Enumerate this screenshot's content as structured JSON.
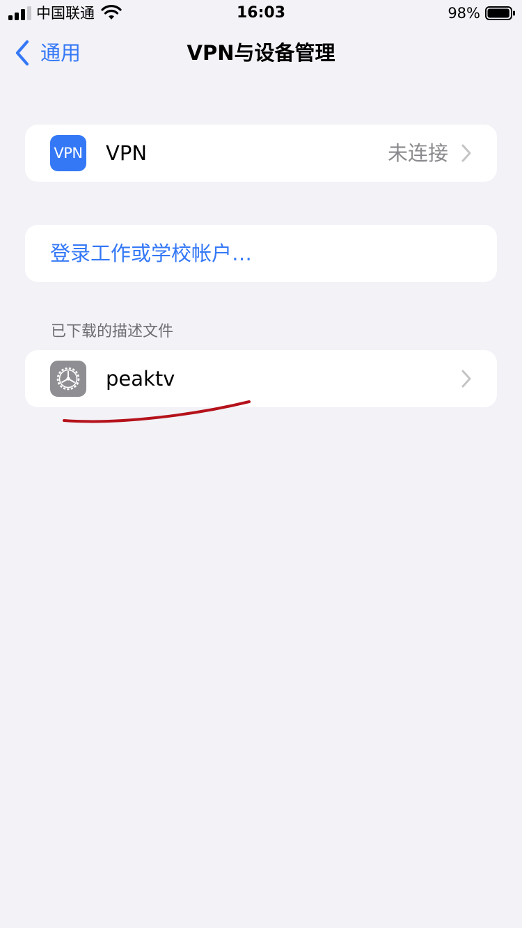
{
  "status_bar": {
    "carrier": "中国联通",
    "time": "16:03",
    "battery_percent": "98%",
    "battery_level": 0.98,
    "signal_icon": "signal-bars-icon",
    "wifi_icon": "wifi-icon",
    "battery_icon": "battery-icon"
  },
  "nav": {
    "back_label": "通用",
    "back_icon": "chevron-left-icon",
    "title": "VPN与设备管理"
  },
  "vpn_row": {
    "icon_text": "VPN",
    "label": "VPN",
    "value": "未连接",
    "chevron_icon": "chevron-right-icon"
  },
  "login_row": {
    "label": "登录工作或学校帐户…"
  },
  "profiles_section": {
    "header": "已下载的描述文件",
    "items": [
      {
        "label": "peaktv",
        "icon": "gear-icon",
        "chevron_icon": "chevron-right-icon"
      }
    ]
  },
  "colors": {
    "accent": "#3478f6",
    "background": "#f2f2f7",
    "secondary_text": "#8a8a8e",
    "annotation": "#b5121b"
  }
}
